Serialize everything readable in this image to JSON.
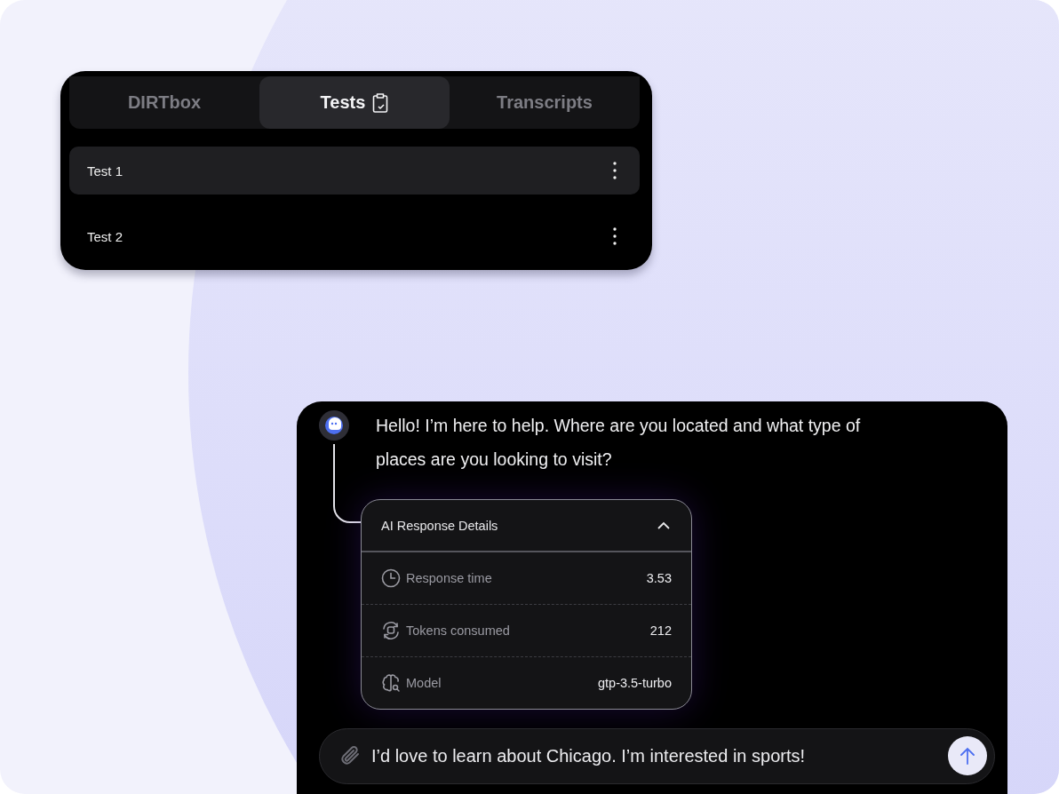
{
  "tabs": [
    {
      "label": "DIRTbox",
      "selected": false
    },
    {
      "label": "Tests",
      "selected": true
    },
    {
      "label": "Transcripts",
      "selected": false
    }
  ],
  "tests": [
    {
      "name": "Test 1",
      "selected": true
    },
    {
      "name": "Test 2",
      "selected": false
    }
  ],
  "chat": {
    "message": "Hello! I’m here to help. Where are you located and what type of places are you looking to visit?",
    "details": {
      "title": "AI Response Details",
      "expanded": true,
      "rows": [
        {
          "kind": "time",
          "label": "Response time",
          "value": "3.53"
        },
        {
          "kind": "tokens",
          "label": "Tokens consumed",
          "value": "212"
        },
        {
          "kind": "model",
          "label": "Model",
          "value": "gtp-3.5-turbo"
        }
      ]
    },
    "input": {
      "value": "I’d love to learn about Chicago. I’m interested in sports!"
    }
  }
}
